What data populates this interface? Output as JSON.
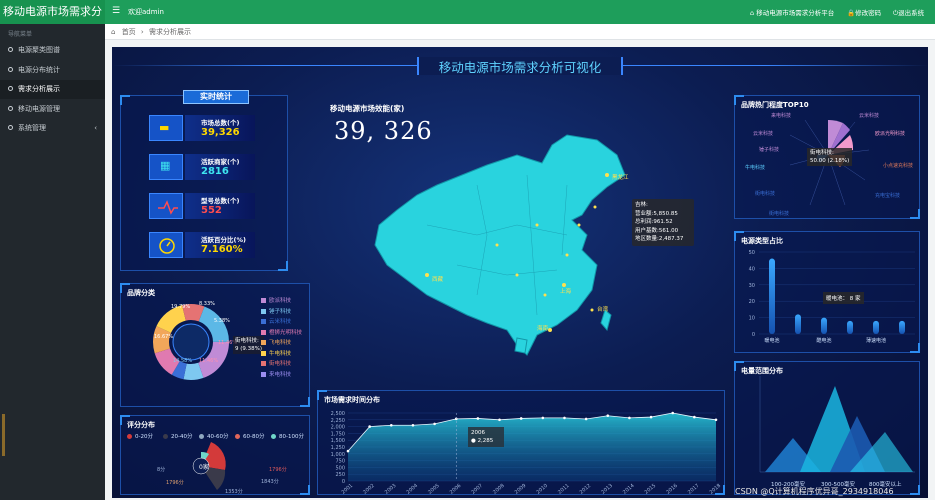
{
  "app": {
    "brand": "移动电源市场需求分析",
    "welcome": "欢迎admin",
    "top_links": [
      "移动电源市场需求分析平台",
      "修改密码",
      "退出系统"
    ]
  },
  "sidebar": {
    "section": "导航菜单",
    "items": [
      "电源聚类图谱",
      "电源分布统计",
      "需求分析展示",
      "移动电源管理",
      "系统管理"
    ]
  },
  "breadcrumb": [
    "首页",
    "需求分析展示"
  ],
  "dashboard": {
    "title": "移动电源市场需求分析可视化",
    "stats_title": "实时统计",
    "stats": [
      {
        "label": "市场总数(个)",
        "value": "39,326",
        "color": "#ffd800",
        "icon": "car-icon"
      },
      {
        "label": "活跃商家(个)",
        "value": "2816",
        "color": "#3ee6f0",
        "icon": "calendar-car-icon"
      },
      {
        "label": "型号总数(个)",
        "value": "552",
        "color": "#ff4d4f",
        "icon": "pulse-icon"
      },
      {
        "label": "活跃百分比(%)",
        "value": "7.160%",
        "color": "#ffd800",
        "icon": "gauge-icon"
      }
    ],
    "map_label": "移动电源市场效能(家)",
    "map_value": "39, 326",
    "map_tooltip": [
      "吉林:",
      "营业额:5,850.85",
      "总利润:961.52",
      "用户基数:561.00",
      "地区数量:2,487.37"
    ],
    "map_cities": [
      "黑龙江",
      "台湾",
      "西藏",
      "海南",
      "上海"
    ],
    "brand_title": "品牌分类",
    "brand_legend": [
      {
        "name": "欧派科技",
        "color": "#c08bd6"
      },
      {
        "name": "锤子科技",
        "color": "#7ec8f0"
      },
      {
        "name": "云米科技",
        "color": "#3a6fd6"
      },
      {
        "name": "橙狮光明科技",
        "color": "#e07ab0"
      },
      {
        "name": "飞电科技",
        "color": "#f2a65a"
      },
      {
        "name": "牛电科技",
        "color": "#ffd24d"
      },
      {
        "name": "街电科技",
        "color": "#e57373"
      },
      {
        "name": "来电科技",
        "color": "#9b8ef0"
      }
    ],
    "brand_pct": [
      "19.79%",
      "8.33%",
      "5.38%",
      "11.46%",
      "11.46%",
      "14.58%",
      "16.67%"
    ],
    "brand_tooltip": [
      "街电科技:",
      "9 (9.38%)"
    ],
    "top10_title": "品牌热门程度TOP10",
    "top10_labels": [
      "来电科技",
      "云米科技",
      "锤子科技",
      "牛电科技",
      "街电科技",
      "街电科技",
      "云米科技",
      "欧派光明科技",
      "小点速充科技",
      "充电宝科技"
    ],
    "top10_tooltip": [
      "街电科技:",
      "50.00 (2.18%)"
    ],
    "type_title": "电源类型占比",
    "type_chart": {
      "type": "bar",
      "categories": [
        "暖电池",
        "",
        "酷电池",
        "",
        "薄速电池",
        ""
      ],
      "values": [
        46,
        12,
        10,
        8,
        8,
        8
      ],
      "ylim": [
        0,
        50
      ],
      "yticks": [
        "0",
        "10",
        "20",
        "30",
        "40",
        "50"
      ],
      "tooltip": "暖电池： 8 家"
    },
    "capacity_title": "电量范围分布",
    "capacity_labels": [
      "100-200毫安",
      "300-500毫安",
      "800毫安以上"
    ],
    "score_title": "评分分布",
    "score_legend": [
      {
        "name": "0-20分",
        "color": "#d33a3a"
      },
      {
        "name": "20-40分",
        "color": "#3a3a4a"
      },
      {
        "name": "40-60分",
        "color": "#8fa8c0"
      },
      {
        "name": "60-80分",
        "color": "#e0665a"
      },
      {
        "name": "80-100分",
        "color": "#6fd6c8"
      }
    ],
    "score_labels": [
      "1796分",
      "0家",
      "8分",
      "1796分",
      "1353分",
      "1843分"
    ],
    "time_title": "市场需求时间分布",
    "time_chart": {
      "type": "area",
      "x": [
        "2001",
        "2002",
        "2003",
        "2004",
        "2005",
        "2006",
        "2007",
        "2008",
        "2009",
        "2010",
        "2011",
        "2012",
        "2013",
        "2014",
        "2015",
        "2016",
        "2017",
        "2018"
      ],
      "values": [
        1100,
        2000,
        2050,
        2050,
        2100,
        2285,
        2300,
        2250,
        2300,
        2320,
        2320,
        2280,
        2400,
        2320,
        2350,
        2500,
        2350,
        2250
      ],
      "ylim": [
        0,
        2500
      ],
      "yticks": [
        "0",
        "250",
        "500",
        "750",
        "1,000",
        "1,250",
        "1,500",
        "1,750",
        "2,000",
        "2,250",
        "2,500"
      ],
      "tooltip_year": "2006",
      "tooltip_value": "2,285"
    },
    "watermark": "CSDN @Q计算机程序优异哥_2934918046"
  }
}
